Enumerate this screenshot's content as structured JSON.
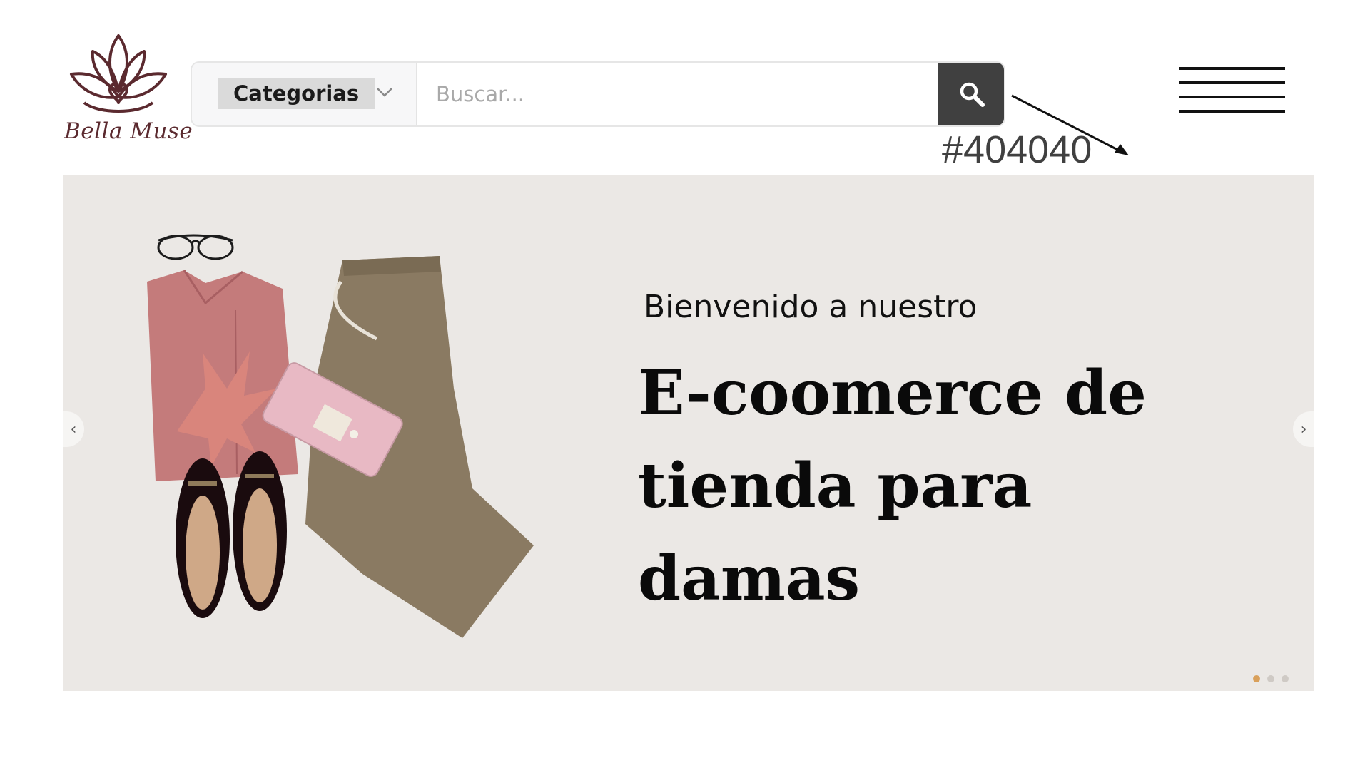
{
  "logo": {
    "text": "Bella Muse",
    "color": "#5b2a2f"
  },
  "search": {
    "category_label": "Categorias",
    "placeholder": "Buscar...",
    "button_icon": "search-icon",
    "button_color": "#404040"
  },
  "annotation": {
    "text": "#404040"
  },
  "menu": {
    "icon": "hamburger-menu-icon"
  },
  "hero": {
    "subtitle": "Bienvenido a nuestro",
    "title": "E-coomerce de tienda para damas",
    "prev_icon": "‹",
    "next_icon": "›",
    "slide_count": 3,
    "active_slide": 1,
    "background_color": "#ebe8e5",
    "active_dot_color": "#d9a05b"
  }
}
